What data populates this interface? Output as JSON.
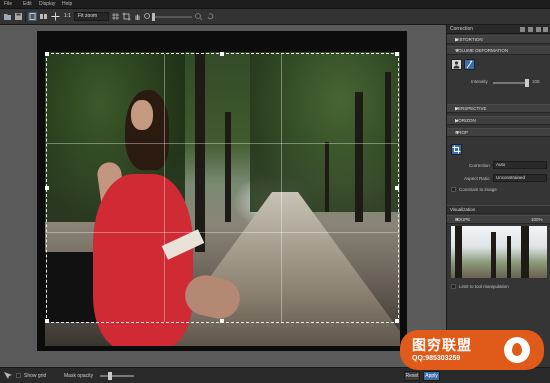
{
  "menu": [
    "File",
    "Edit",
    "Display",
    "Help"
  ],
  "toolbar": {
    "zoom_ratio": "1:1",
    "zoom_value": "Fit zoom"
  },
  "panel": {
    "title": "Correction",
    "distortion": "DISTORTION",
    "volume_deformation": "VOLUME DEFORMATION",
    "intensity_label": "Intensity",
    "intensity_value": "100",
    "perspective": "PERSPECTIVE",
    "horizon": "HORIZON",
    "crop": "CROP",
    "correction_label": "Correction",
    "correction_value": "Auto",
    "aspect_label": "Aspect Ratio",
    "aspect_value": "Unconstrained",
    "constrain_label": "Constrain to image",
    "visualization": "Visualization",
    "loupe": "LOUPE",
    "loupe_zoom": "100%",
    "limit_label": "Limit to tool manipulation"
  },
  "bottom": {
    "show_grid": "Show grid",
    "mask_opacity": "Mask opacity",
    "reset": "Reset",
    "apply": "Apply"
  },
  "watermark": {
    "line1": "图穷联盟",
    "line2": "QQ:985303259"
  },
  "colors": {
    "accent": "#3b6ea8",
    "dress": "#d02a35",
    "watermark": "#e05a1a"
  }
}
